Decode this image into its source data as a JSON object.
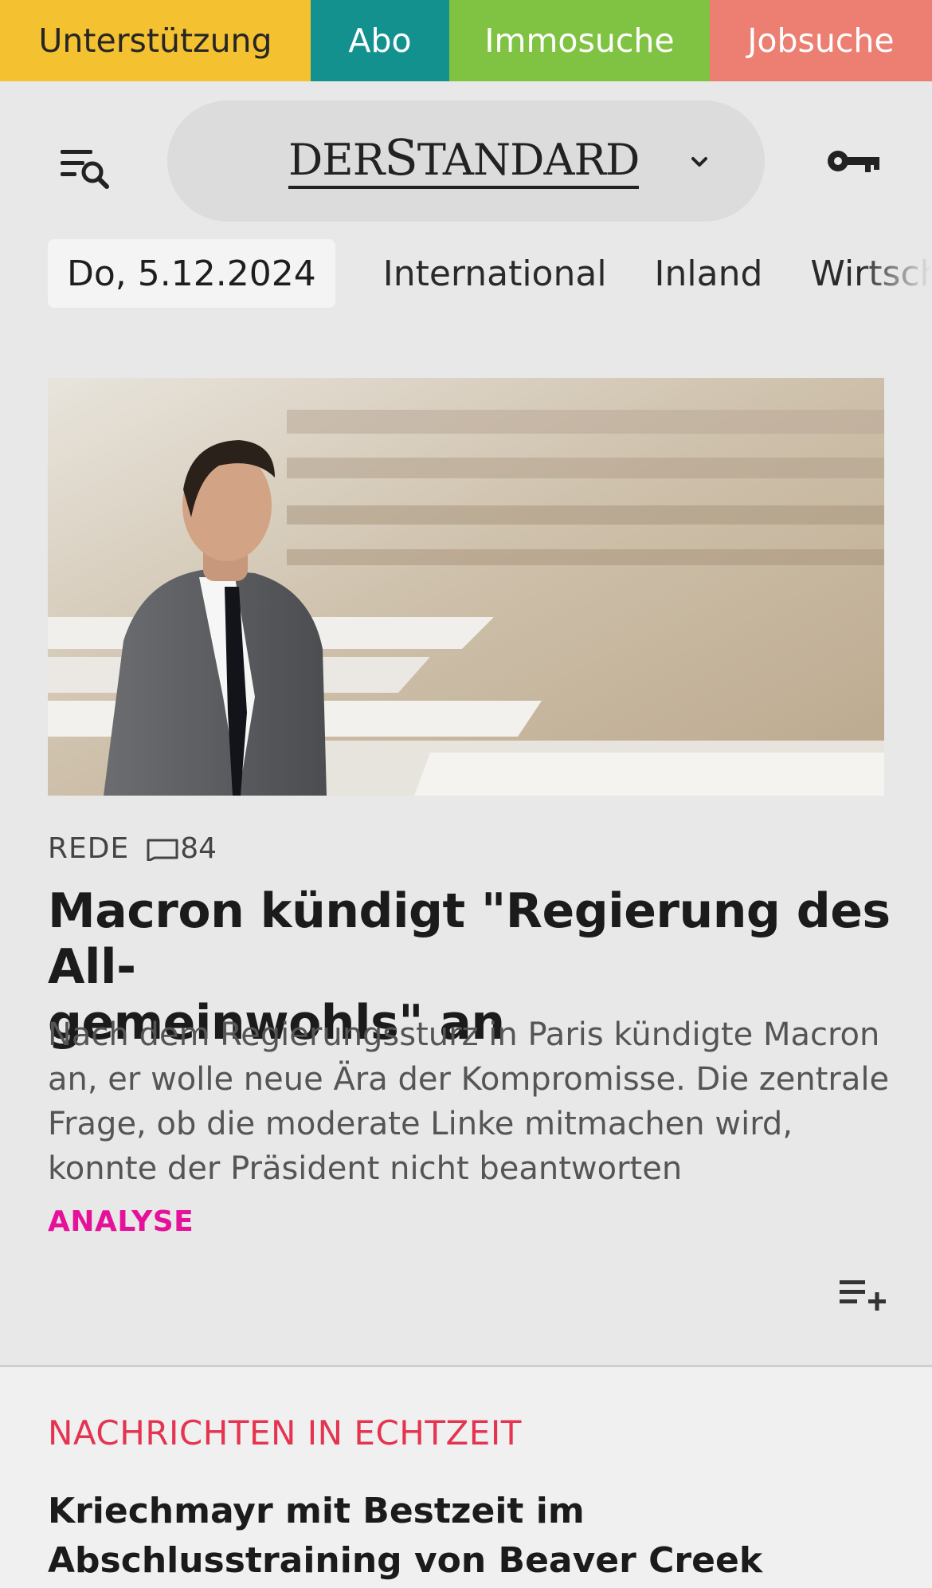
{
  "service_bar": {
    "items": [
      "Unterstützung",
      "Abo",
      "Immosuche",
      "Jobsuche"
    ]
  },
  "header": {
    "logo": "DERSTANDARD",
    "logo_parts": [
      "DER",
      "S",
      "TANDARD"
    ]
  },
  "section_nav": {
    "date": "Do, 5.12.2024",
    "items": [
      "International",
      "Inland",
      "Wirtschaft"
    ]
  },
  "hero": {
    "kicker": "REDE",
    "comment_count": "84",
    "title": "Macron kündigt \"Regierung des All-gemeinwohls\" an",
    "title_line1": "Macron kündigt \"Regierung des All-",
    "title_line2": "gemeinwohls\" an",
    "teaser": "Nach dem Regierungssturz in Paris kündigte Macron an, er wolle neue Ära der Kompromisse. Die zentrale Frage, ob die moderate Linke mitmachen wird, konnte der Präsident nicht beantworten",
    "label": "ANALYSE"
  },
  "live": {
    "heading": "NACHRICHTEN IN ECHTZEIT",
    "headline": "Kriechmayr mit Bestzeit im Abschlusstraining von Beaver Creek"
  },
  "colors": {
    "unterstuetzung": "#f4c131",
    "abo": "#13918e",
    "immosuche": "#80c342",
    "jobsuche": "#ec7e72",
    "analyse": "#e6119a",
    "live_heading": "#e4344f"
  },
  "icons": [
    "menu-search-icon",
    "chevron-down-icon",
    "key-icon",
    "comment-icon",
    "playlist-add-icon"
  ]
}
